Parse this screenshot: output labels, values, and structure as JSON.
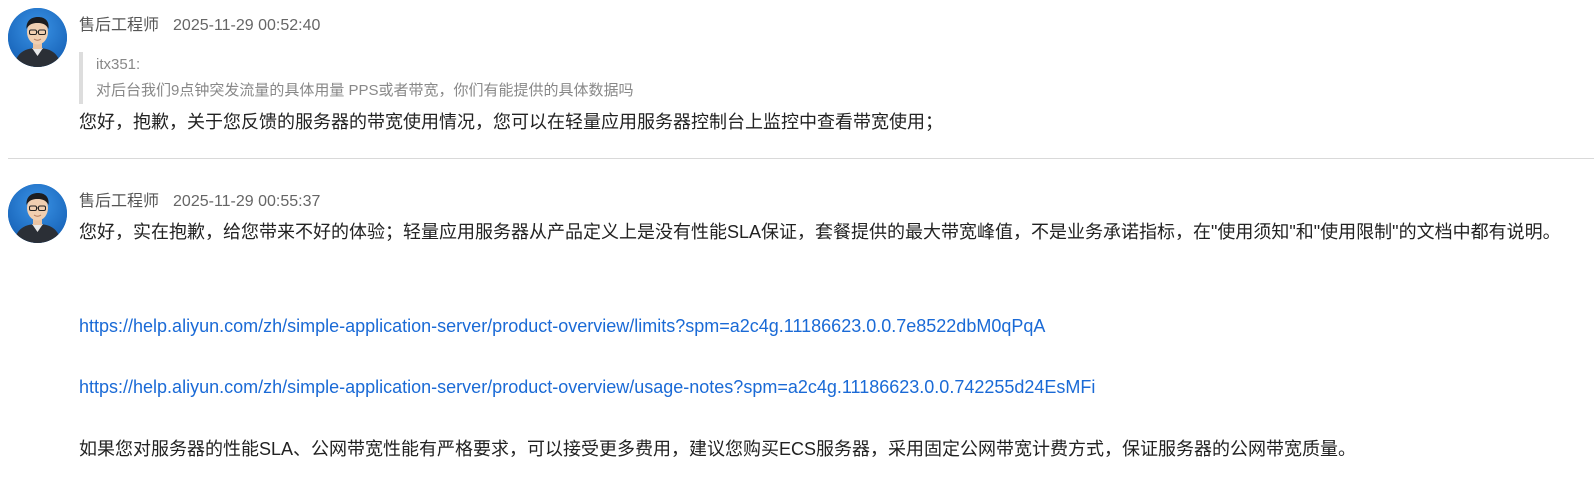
{
  "messages": [
    {
      "author": "售后工程师",
      "time": "2025-11-29 00:52:40",
      "quote": {
        "user": "itx351:",
        "text": "对后台我们9点钟突发流量的具体用量 PPS或者带宽，你们有能提供的具体数据吗"
      },
      "body": "您好，抱歉，关于您反馈的服务器的带宽使用情况，您可以在轻量应用服务器控制台上监控中查看带宽使用；"
    },
    {
      "author": "售后工程师",
      "time": "2025-11-29 00:55:37",
      "paragraph_1": "您好，实在抱歉，给您带来不好的体验；轻量应用服务器从产品定义上是没有性能SLA保证，套餐提供的最大带宽峰值，不是业务承诺指标，在\"使用须知\"和\"使用限制\"的文档中都有说明。",
      "link_1": "https://help.aliyun.com/zh/simple-application-server/product-overview/limits?spm=a2c4g.11186623.0.0.7e8522dbM0qPqA",
      "link_2": "https://help.aliyun.com/zh/simple-application-server/product-overview/usage-notes?spm=a2c4g.11186623.0.0.742255d24EsMFi",
      "paragraph_2": "如果您对服务器的性能SLA、公网带宽性能有严格要求，可以接受更多费用，建议您购买ECS服务器，采用固定公网带宽计费方式，保证服务器的公网带宽质量。"
    }
  ],
  "colors": {
    "link": "#1a6ad6",
    "text": "#222222",
    "meta": "#555555",
    "quote_text": "#888888",
    "quote_bar": "#dddddd",
    "divider": "#d9d9d9",
    "avatar_bg": "#1e73c8"
  },
  "icons": {
    "avatar": "engineer-avatar-icon"
  }
}
